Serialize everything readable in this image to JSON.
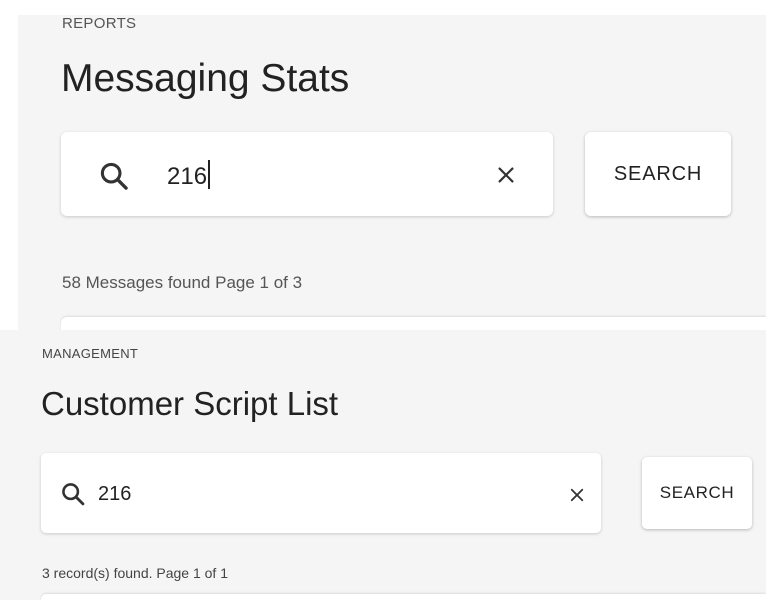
{
  "reports_panel": {
    "section_label": "REPORTS",
    "page_title": "Messaging Stats",
    "search": {
      "value": "216",
      "search_icon": "search-icon",
      "clear_icon": "close-icon"
    },
    "search_button_label": "SEARCH",
    "result_status": "58 Messages found Page 1 of 3"
  },
  "management_panel": {
    "section_label": "MANAGEMENT",
    "page_title": "Customer Script List",
    "search": {
      "value": "216",
      "search_icon": "search-icon",
      "clear_icon": "close-icon"
    },
    "search_button_label": "SEARCH",
    "result_status": "3 record(s) found. Page 1 of 1"
  },
  "colors": {
    "panel_background": "#f5f5f5",
    "card_background": "#ffffff",
    "text_primary": "#222222",
    "text_secondary": "#555555"
  }
}
